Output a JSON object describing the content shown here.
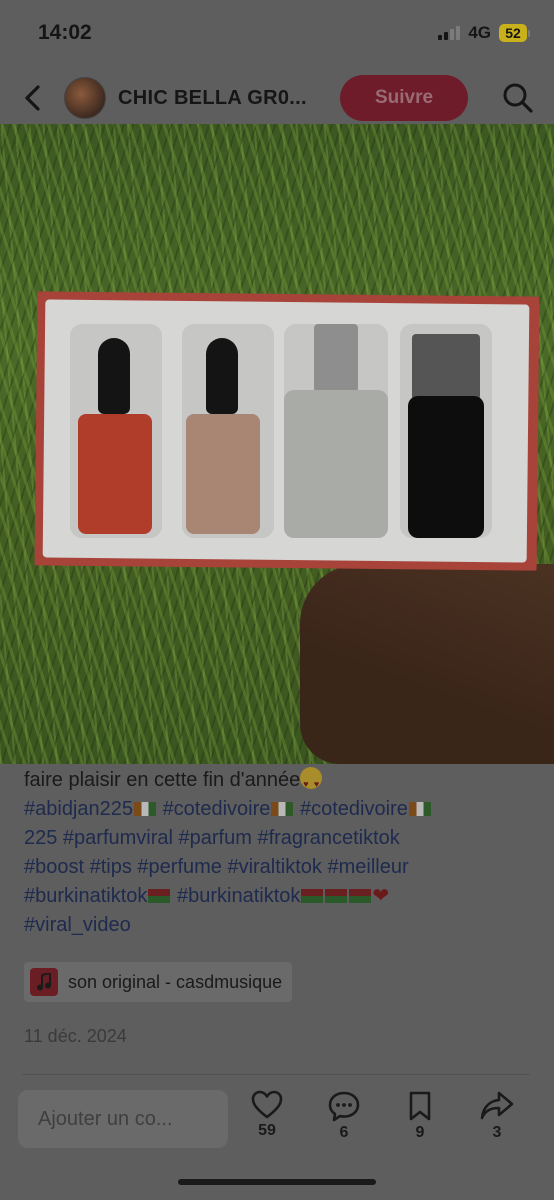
{
  "status_bar": {
    "time": "14:02",
    "network": "4G",
    "battery": "52"
  },
  "header": {
    "account_name": "CHIC BELLA GR0...",
    "follow_label": "Suivre"
  },
  "post": {
    "caption_lines": [
      [
        {
          "t": "faire plaisir en cette fin d'année",
          "k": "text"
        },
        {
          "t": "heart-eyes-emoji",
          "k": "emoji"
        }
      ],
      [
        {
          "t": "#abidjan225",
          "k": "tag"
        },
        {
          "t": "flag-ci",
          "k": "flag"
        },
        {
          "t": " ",
          "k": "text"
        },
        {
          "t": "#cotedivoire",
          "k": "tag"
        },
        {
          "t": "flag-ci",
          "k": "flag"
        },
        {
          "t": " ",
          "k": "text"
        },
        {
          "t": "#cotedivoire",
          "k": "tag"
        },
        {
          "t": "flag-ci",
          "k": "flag"
        }
      ],
      [
        {
          "t": "225 #parfumviral #parfum #fragrancetiktok",
          "k": "tag"
        }
      ],
      [
        {
          "t": "#boost #tips #perfume #viraltiktok #meilleur",
          "k": "tag"
        }
      ],
      [
        {
          "t": "#burkinatiktok",
          "k": "tag"
        },
        {
          "t": "flag-bf",
          "k": "flag"
        },
        {
          "t": " ",
          "k": "text"
        },
        {
          "t": "#burkinatiktok",
          "k": "tag"
        },
        {
          "t": "flag-bf",
          "k": "flag"
        },
        {
          "t": "flag-bf",
          "k": "flag"
        },
        {
          "t": "flag-bf",
          "k": "flag"
        },
        {
          "t": "red-heart",
          "k": "heart"
        }
      ],
      [
        {
          "t": "#viral_video",
          "k": "tag"
        }
      ]
    ],
    "sound": "son original - casdmusique",
    "date": "11 déc. 2024"
  },
  "footer": {
    "comment_placeholder": "Ajouter un co...",
    "likes": "59",
    "comments": "6",
    "saves": "9",
    "shares": "3"
  },
  "colors": {
    "follow_bg": "#6e1c2a",
    "hashtag": "#1e2a4e",
    "overlay_bg": "#5e5e5e"
  },
  "icons": [
    "back-arrow-icon",
    "search-icon",
    "music-note-icon",
    "heart-icon",
    "comment-icon",
    "bookmark-icon",
    "share-icon"
  ]
}
